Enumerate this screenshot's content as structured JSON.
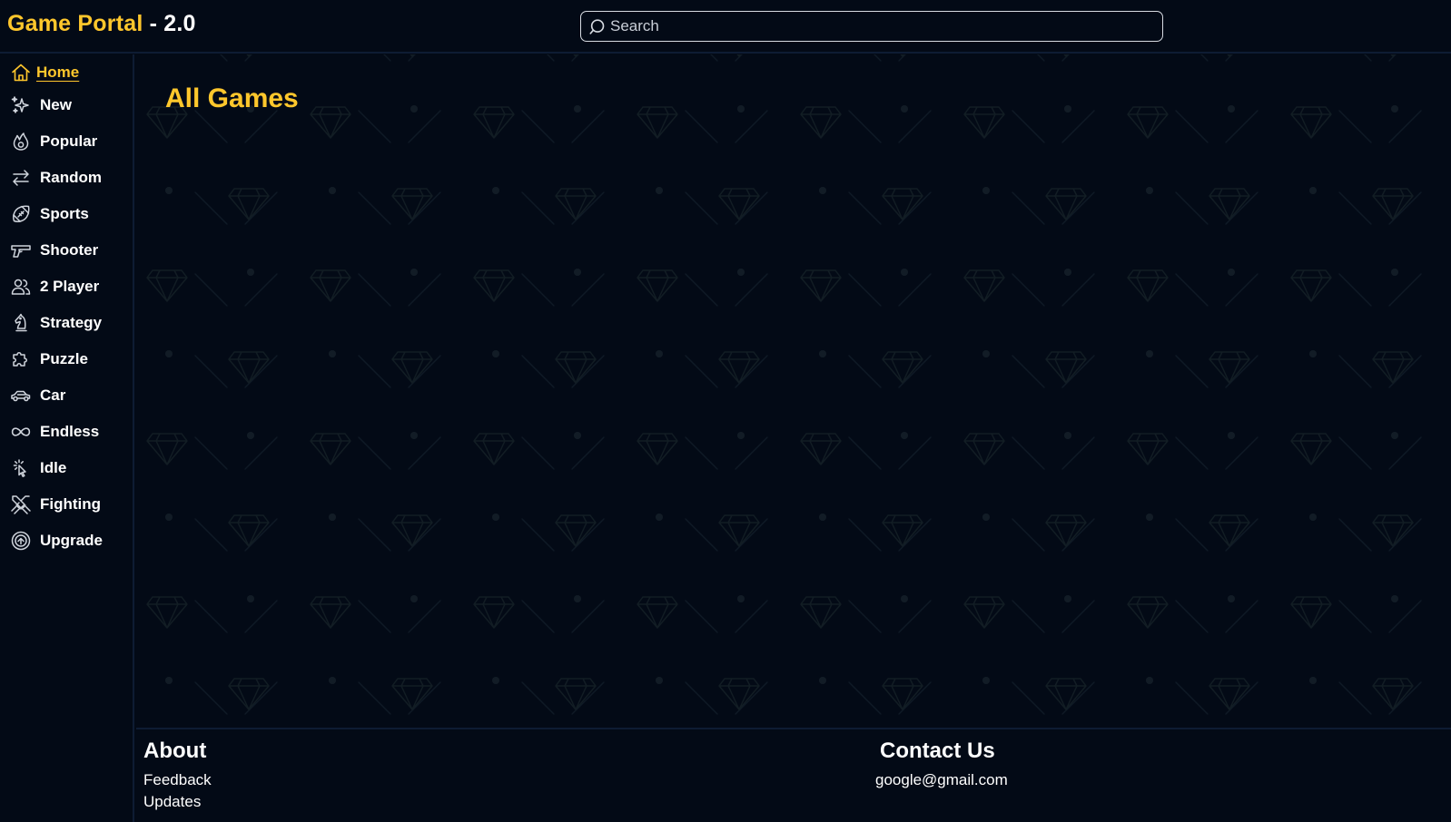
{
  "header": {
    "brand_name": "Game Portal",
    "brand_version": " - 2.0",
    "search_placeholder": "Search"
  },
  "sidebar": {
    "items": [
      {
        "label": "Home",
        "icon": "home-icon",
        "active": true
      },
      {
        "label": "New",
        "icon": "sparkles-icon"
      },
      {
        "label": "Popular",
        "icon": "fire-icon"
      },
      {
        "label": "Random",
        "icon": "arrows-swap-icon"
      },
      {
        "label": "Sports",
        "icon": "football-icon"
      },
      {
        "label": "Shooter",
        "icon": "gun-icon"
      },
      {
        "label": "2 Player",
        "icon": "users-icon"
      },
      {
        "label": "Strategy",
        "icon": "chess-knight-icon"
      },
      {
        "label": "Puzzle",
        "icon": "puzzle-icon"
      },
      {
        "label": "Car",
        "icon": "car-icon"
      },
      {
        "label": "Endless",
        "icon": "infinity-icon"
      },
      {
        "label": "Idle",
        "icon": "pointer-click-icon"
      },
      {
        "label": "Fighting",
        "icon": "crossed-swords-icon"
      },
      {
        "label": "Upgrade",
        "icon": "upgrade-badge-icon"
      }
    ]
  },
  "main": {
    "title": "All Games"
  },
  "footer": {
    "about_heading": "About",
    "feedback_link": "Feedback",
    "updates_link": "Updates",
    "contact_heading": "Contact Us",
    "contact_email": "google@gmail.com"
  },
  "colors": {
    "accent": "#ffc72c",
    "background": "#030a16",
    "divider": "#0e1c33"
  }
}
